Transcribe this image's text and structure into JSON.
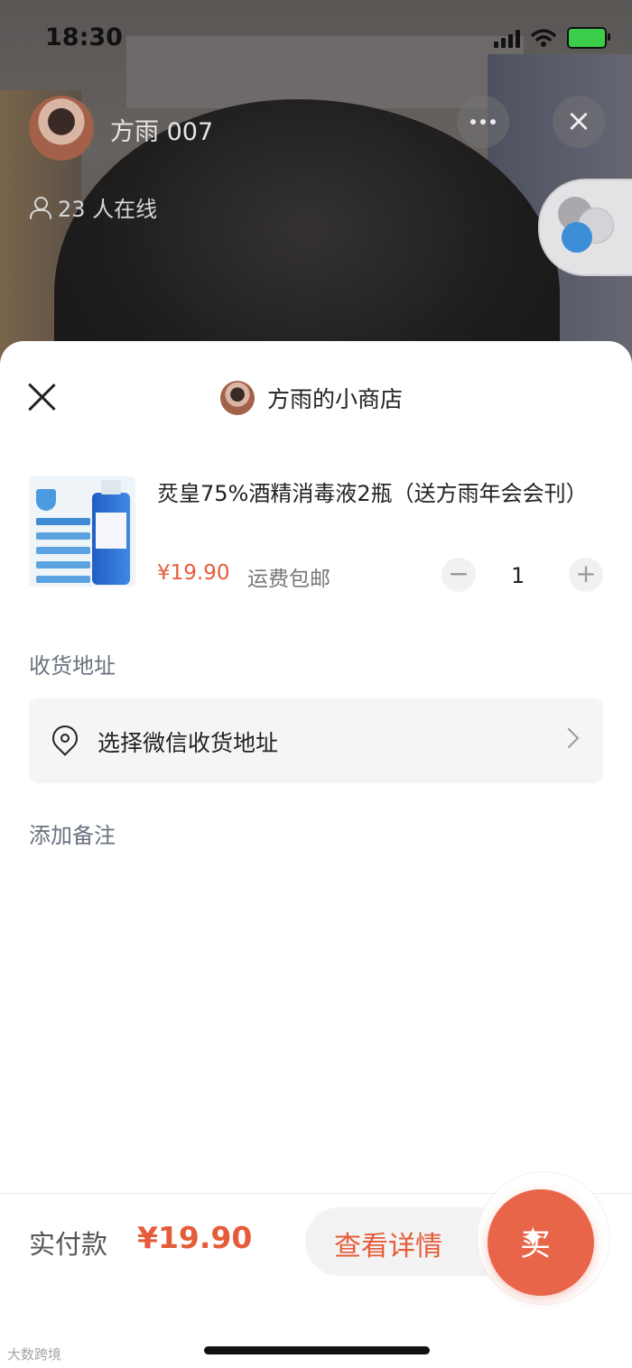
{
  "status_bar": {
    "time": "18:30"
  },
  "live": {
    "streamer_name": "方雨 007",
    "viewer_count": "23 人在线"
  },
  "sheet": {
    "shop_name": "方雨的小商店",
    "product": {
      "title": "烎皇75%酒精消毒液2瓶（送方雨年会会刊）",
      "price": "¥19.90",
      "shipping": "运费包邮",
      "quantity": "1",
      "minus_label": "−",
      "plus_label": "+"
    },
    "address_label": "收货地址",
    "address_placeholder": "选择微信收货地址",
    "note_label": "添加备注"
  },
  "bottom_bar": {
    "pay_label": "实付款",
    "pay_amount": "¥19.90",
    "details_label": "查看详情",
    "buy_label": "买"
  },
  "watermark": "大数跨境",
  "colors": {
    "accent": "#e55c3a",
    "buy_button": "#e8654a"
  }
}
